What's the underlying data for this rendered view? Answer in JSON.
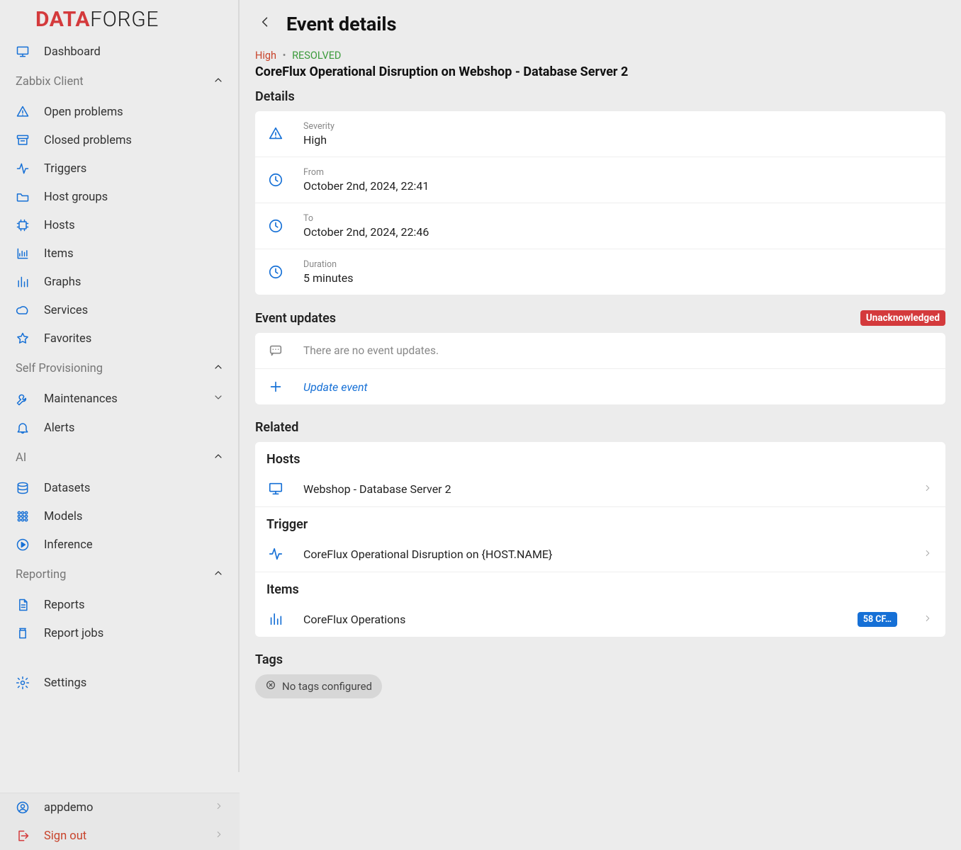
{
  "logo": {
    "part1": "DATA",
    "part2": "FORGE"
  },
  "sidebar": {
    "dashboard": "Dashboard",
    "sections": {
      "zabbix": "Zabbix Client",
      "self": "Self Provisioning",
      "ai": "AI",
      "reporting": "Reporting"
    },
    "items": {
      "open_problems": "Open problems",
      "closed_problems": "Closed problems",
      "triggers": "Triggers",
      "host_groups": "Host groups",
      "hosts": "Hosts",
      "items": "Items",
      "graphs": "Graphs",
      "services": "Services",
      "favorites": "Favorites",
      "maintenances": "Maintenances",
      "alerts": "Alerts",
      "datasets": "Datasets",
      "models": "Models",
      "inference": "Inference",
      "reports": "Reports",
      "report_jobs": "Report jobs",
      "settings": "Settings"
    },
    "user": "appdemo",
    "signout": "Sign out"
  },
  "page": {
    "title": "Event details",
    "severity": "High",
    "status": "RESOLVED",
    "event_name": "CoreFlux Operational Disruption on Webshop - Database Server 2"
  },
  "details": {
    "heading": "Details",
    "severity_label": "Severity",
    "severity_value": "High",
    "from_label": "From",
    "from_value": "October 2nd, 2024, 22:41",
    "to_label": "To",
    "to_value": "October 2nd, 2024, 22:46",
    "duration_label": "Duration",
    "duration_value": "5 minutes"
  },
  "updates": {
    "heading": "Event updates",
    "badge": "Unacknowledged",
    "empty": "There are no event updates.",
    "action": "Update event"
  },
  "related": {
    "heading": "Related",
    "hosts_h": "Hosts",
    "host": "Webshop - Database Server 2",
    "trigger_h": "Trigger",
    "trigger": "CoreFlux Operational Disruption on {HOST.NAME}",
    "items_h": "Items",
    "item": "CoreFlux Operations",
    "item_badge": "58 CF…"
  },
  "tags": {
    "heading": "Tags",
    "empty": "No tags configured"
  }
}
